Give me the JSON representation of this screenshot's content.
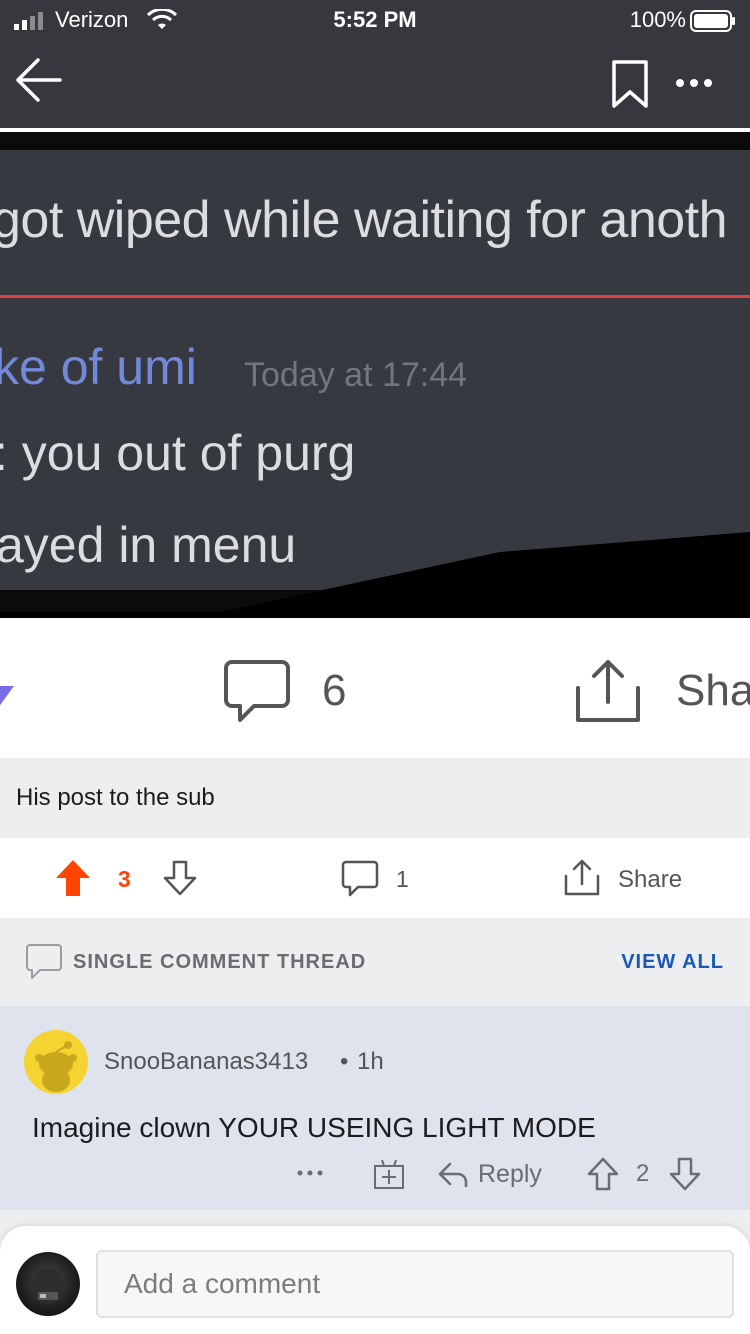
{
  "status_bar": {
    "carrier": "Verizon",
    "time": "5:52 PM",
    "battery": "100%"
  },
  "post_image": {
    "line1": "got wiped while waiting for anoth",
    "name": "ke of umi",
    "timestamp": "Today at 17:44",
    "line3": ": you out of purg",
    "line4": "ayed in menu"
  },
  "post_actions": {
    "comment_count": "6",
    "share_label": "Sha"
  },
  "comment_preview": {
    "text": "His post to the sub",
    "vote_count": "3",
    "reply_count": "1",
    "share_label": "Share"
  },
  "thread": {
    "label": "SINGLE COMMENT THREAD",
    "view_all": "VIEW ALL"
  },
  "comment": {
    "username": "SnooBananas3413",
    "separator": "•",
    "age": "1h",
    "body": "Imagine clown YOUR USEING LIGHT MODE",
    "reply_label": "Reply",
    "score": "2"
  },
  "composer": {
    "placeholder": "Add a comment"
  },
  "colors": {
    "nav_bg": "#36383d",
    "upvote": "#ff4500",
    "link_blue": "#1a58b8",
    "comment_bg": "#dfe3ee"
  }
}
